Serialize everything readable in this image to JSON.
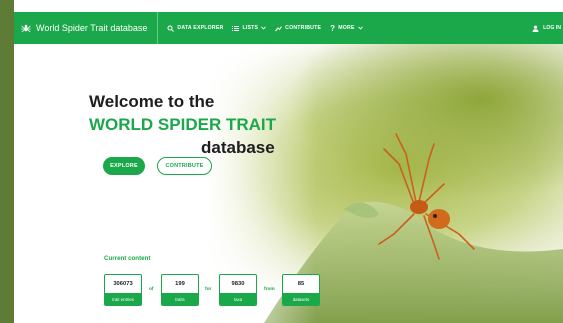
{
  "navbar": {
    "brand": "World Spider Trait database",
    "items": [
      {
        "label": "DATA EXPLORER",
        "icon": "search-icon"
      },
      {
        "label": "LISTS",
        "icon": "list-icon"
      },
      {
        "label": "CONTRIBUTE",
        "icon": "chart-trend-icon"
      },
      {
        "label": "MORE",
        "icon": "question-icon"
      }
    ],
    "login": "LOG IN"
  },
  "hero": {
    "title_line1": "Welcome to the",
    "title_line2": "WORLD SPIDER TRAIT",
    "title_line3": "database",
    "explore_label": "EXPLORE",
    "contribute_label": "CONTRIBUTE"
  },
  "current": {
    "title": "Current content",
    "stats": [
      {
        "value": "306073",
        "label": "trait entries"
      },
      {
        "value": "199",
        "label": "traits"
      },
      {
        "value": "9830",
        "label": "taxa"
      },
      {
        "value": "85",
        "label": "datasets"
      }
    ],
    "connectors": [
      "of",
      "for",
      "from"
    ]
  },
  "colors": {
    "brand_green": "#1aa84a",
    "dark_text": "#1e1e1e",
    "frame_green": "#5f7c36"
  }
}
